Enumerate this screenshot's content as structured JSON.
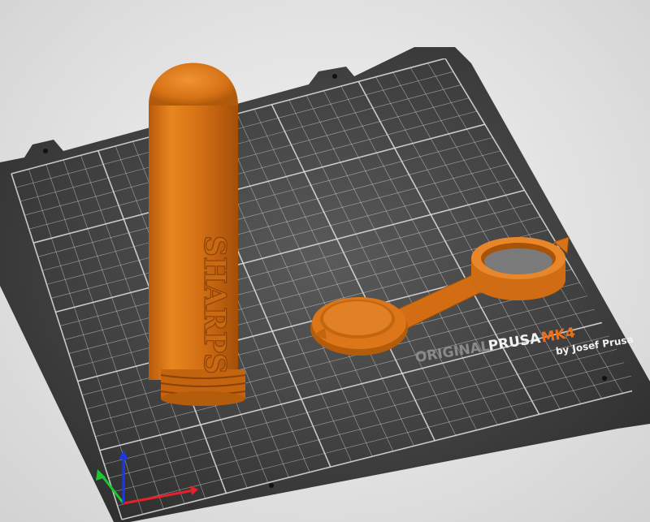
{
  "app": {
    "view": "3D plater preview"
  },
  "bed": {
    "brand_prefix": "ORIGINAL",
    "brand_name": "PRUSA",
    "brand_model": "MK4",
    "brand_byline": "by Josef Prusa"
  },
  "objects": [
    {
      "name": "sharps-container-tube",
      "embossed_text": "SHARPS"
    },
    {
      "name": "container-cap"
    }
  ],
  "colors": {
    "filament": "#e07a1c",
    "bed": "#3c3c3c",
    "grid": "#d8d8d8",
    "axis_x": "#e8202a",
    "axis_y": "#19c832",
    "axis_z": "#1a3ae8"
  }
}
